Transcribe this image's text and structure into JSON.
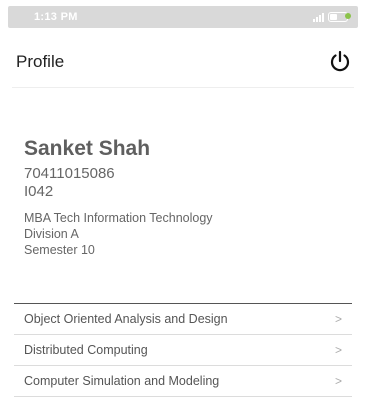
{
  "status_bar": {
    "time": "1:13 PM",
    "icons": [
      "signal-icon",
      "battery-charging-icon"
    ]
  },
  "app_bar": {
    "title": "Profile",
    "action_icon": "power-icon"
  },
  "profile": {
    "name": "Sanket Shah",
    "roll_number": "70411015086",
    "sap_id": "I042",
    "program": "MBA Tech Information Technology",
    "division": "Division A",
    "semester": "Semester 10"
  },
  "subjects": [
    {
      "label": "Object Oriented Analysis and Design",
      "chevron": ">"
    },
    {
      "label": "Distributed Computing",
      "chevron": ">"
    },
    {
      "label": "Computer Simulation and Modeling",
      "chevron": ">"
    }
  ]
}
